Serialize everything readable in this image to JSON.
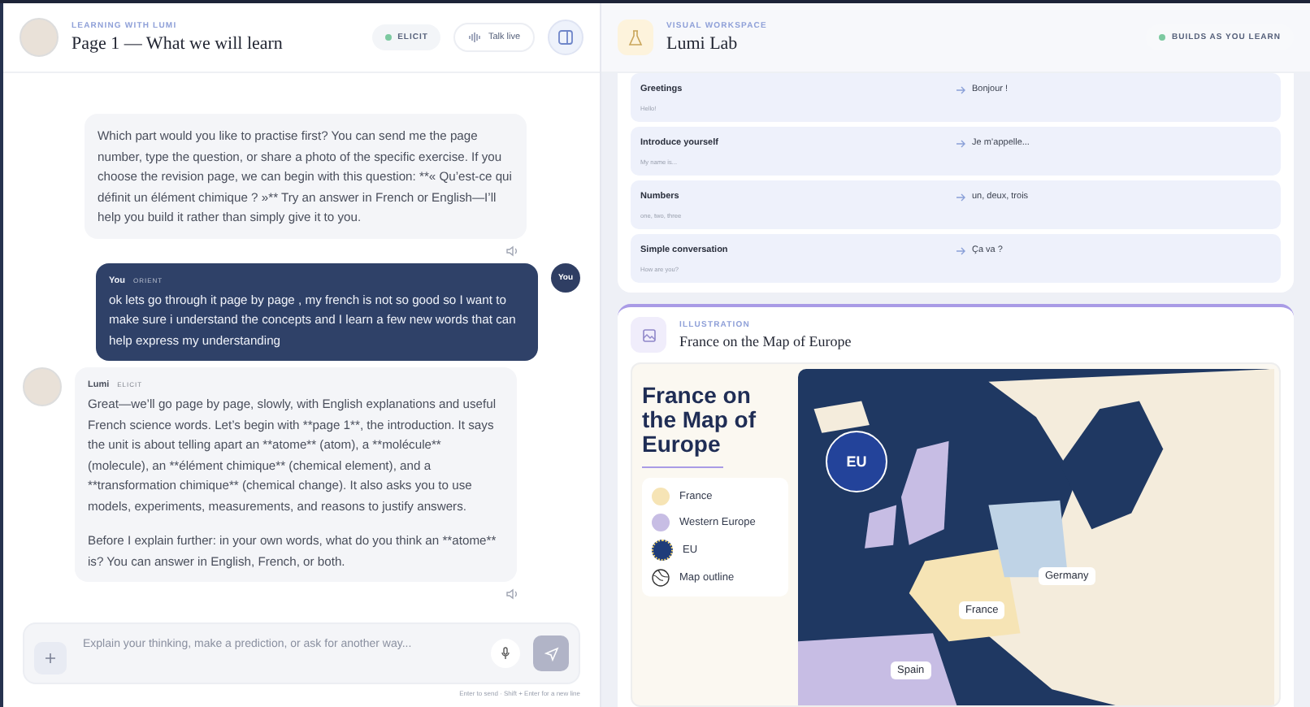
{
  "chat": {
    "header": {
      "eyebrow": "LEARNING WITH LUMI",
      "title": "Page 1 — What we will learn",
      "mode_badge": "ELICIT",
      "talk_button": "Talk live"
    },
    "messages": [
      {
        "kind": "assistant",
        "paragraphs": [
          "Which part would you like to practise first? You can send me the page number, type the question, or share a photo of the specific exercise. If you choose the revision page, we can begin with this question: **« Qu’est-ce qui définit un élément chimique ? »** Try an answer in French or English—I’ll help you build it rather than simply give it to you."
        ]
      },
      {
        "kind": "user",
        "author": "You",
        "tag": "ORIENT",
        "avatar": "You",
        "paragraphs": [
          "ok lets go through it page by page , my french is not so good so I want to make sure i understand the concepts and I learn a few new words that can help express my understanding"
        ]
      },
      {
        "kind": "assistant",
        "author": "Lumi",
        "tag": "ELICIT",
        "paragraphs": [
          "Great—we’ll go page by page, slowly, with English explanations and useful French science words. Let’s begin with **page 1**, the introduction. It says the unit is about telling apart an **atome** (atom), a **molécule** (molecule), an **élément chimique** (chemical element), and a **transformation chimique** (chemical change). It also asks you to use models, experiments, measurements, and reasons to justify answers.",
          "Before I explain further: in your own words, what do you think an **atome** is? You can answer in English, French, or both."
        ]
      }
    ],
    "composer": {
      "placeholder": "Explain your thinking, make a prediction, or ask for another way...",
      "hint": "Enter to send · Shift + Enter for a new line"
    }
  },
  "workspace": {
    "eyebrow": "VISUAL WORKSPACE",
    "title": "Lumi Lab",
    "badge": "BUILDS AS YOU LEARN",
    "phrases": [
      {
        "label": "Greetings",
        "gloss": "Hello!",
        "translation": "Bonjour !"
      },
      {
        "label": "Introduce yourself",
        "gloss": "My name is...",
        "translation": "Je m’appelle..."
      },
      {
        "label": "Numbers",
        "gloss": "one, two, three",
        "translation": "un, deux, trois"
      },
      {
        "label": "Simple conversation",
        "gloss": "How are you?",
        "translation": "Ça va ?"
      }
    ],
    "illustration": {
      "eyebrow": "ILLUSTRATION",
      "title": "France on the Map of Europe",
      "poster_title": "France on the Map of Europe",
      "badge": "EU",
      "legend": [
        {
          "kind": "swatch",
          "label": "France",
          "color": "#f6e4b5"
        },
        {
          "kind": "swatch",
          "label": "Western Europe",
          "color": "#c7bde4"
        },
        {
          "kind": "eu",
          "label": "EU",
          "color": "#1f3d7a"
        },
        {
          "kind": "outline",
          "label": "Map outline"
        }
      ],
      "map_labels": [
        "Germany",
        "France",
        "Spain"
      ]
    }
  }
}
